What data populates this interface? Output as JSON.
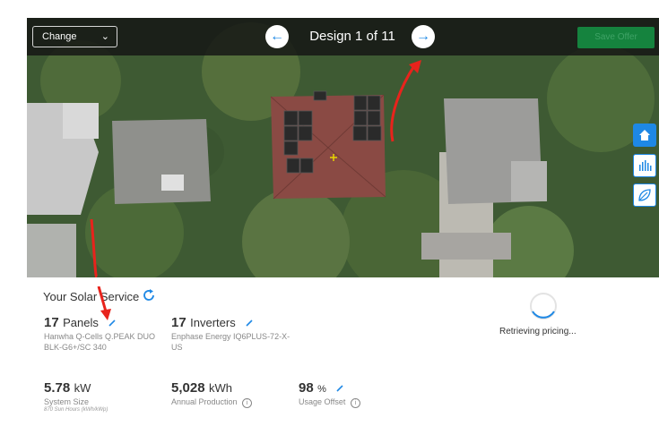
{
  "toolbar": {
    "change_label": "Change",
    "design_title": "Design 1 of 11",
    "save_label": "Save Offer",
    "prev_icon": "arrow-left-icon",
    "next_icon": "arrow-right-icon"
  },
  "side_tools": [
    "home-icon",
    "bar-chart-icon",
    "leaf-icon"
  ],
  "summary": {
    "title": "Your Solar Service",
    "panels": {
      "count": "17",
      "label": "Panels",
      "model_line1": "Hanwha Q-Cells Q.PEAK DUO",
      "model_line2": "BLK-G6+/SC 340"
    },
    "inverters": {
      "count": "17",
      "label": "Inverters",
      "model_line1": "Enphase Energy IQ6PLUS-72-X-",
      "model_line2": "US"
    },
    "system_size": {
      "value": "5.78",
      "unit": "kW",
      "label": "System Size",
      "note": "870 Sun Hours (kWh/kWp)"
    },
    "annual_production": {
      "value": "5,028",
      "unit": "kWh",
      "label": "Annual Production"
    },
    "usage_offset": {
      "value": "98",
      "unit": "%",
      "label": "Usage Offset"
    }
  },
  "pricing": {
    "status": "Retrieving pricing..."
  },
  "colors": {
    "accent": "#1e88e5",
    "save_green": "#15833e",
    "annotation_red": "#e8231c"
  }
}
